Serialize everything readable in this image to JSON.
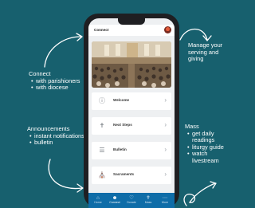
{
  "callouts": {
    "connect": {
      "heading": "Connect",
      "items": [
        "with parishioners",
        "with diocese"
      ]
    },
    "announcements": {
      "heading": "Announcements",
      "items": [
        "instant notifications",
        "bulletin"
      ]
    },
    "manage": {
      "text": "Manage your serving and giving"
    },
    "mass": {
      "heading": "Mass",
      "items": [
        "get daily readings",
        "liturgy guide",
        "watch livestream"
      ]
    }
  },
  "app": {
    "title": "Connect",
    "menu": [
      {
        "label": "Welcome",
        "icon": "info-icon"
      },
      {
        "label": "Next Steps",
        "icon": "signpost-icon"
      },
      {
        "label": "Bulletin",
        "icon": "list-icon"
      },
      {
        "label": "Sacraments",
        "icon": "church-icon"
      }
    ],
    "tabs": [
      {
        "label": "Home",
        "icon": "home-icon"
      },
      {
        "label": "Connect",
        "icon": "people-icon"
      },
      {
        "label": "Donate",
        "icon": "donate-icon"
      },
      {
        "label": "Mass",
        "icon": "cross-icon"
      },
      {
        "label": "More",
        "icon": "more-icon"
      }
    ],
    "active_tab": "Connect"
  },
  "colors": {
    "background": "#17606e",
    "tabbar": "#0f6da8",
    "phone_frame": "#1f1f22"
  }
}
